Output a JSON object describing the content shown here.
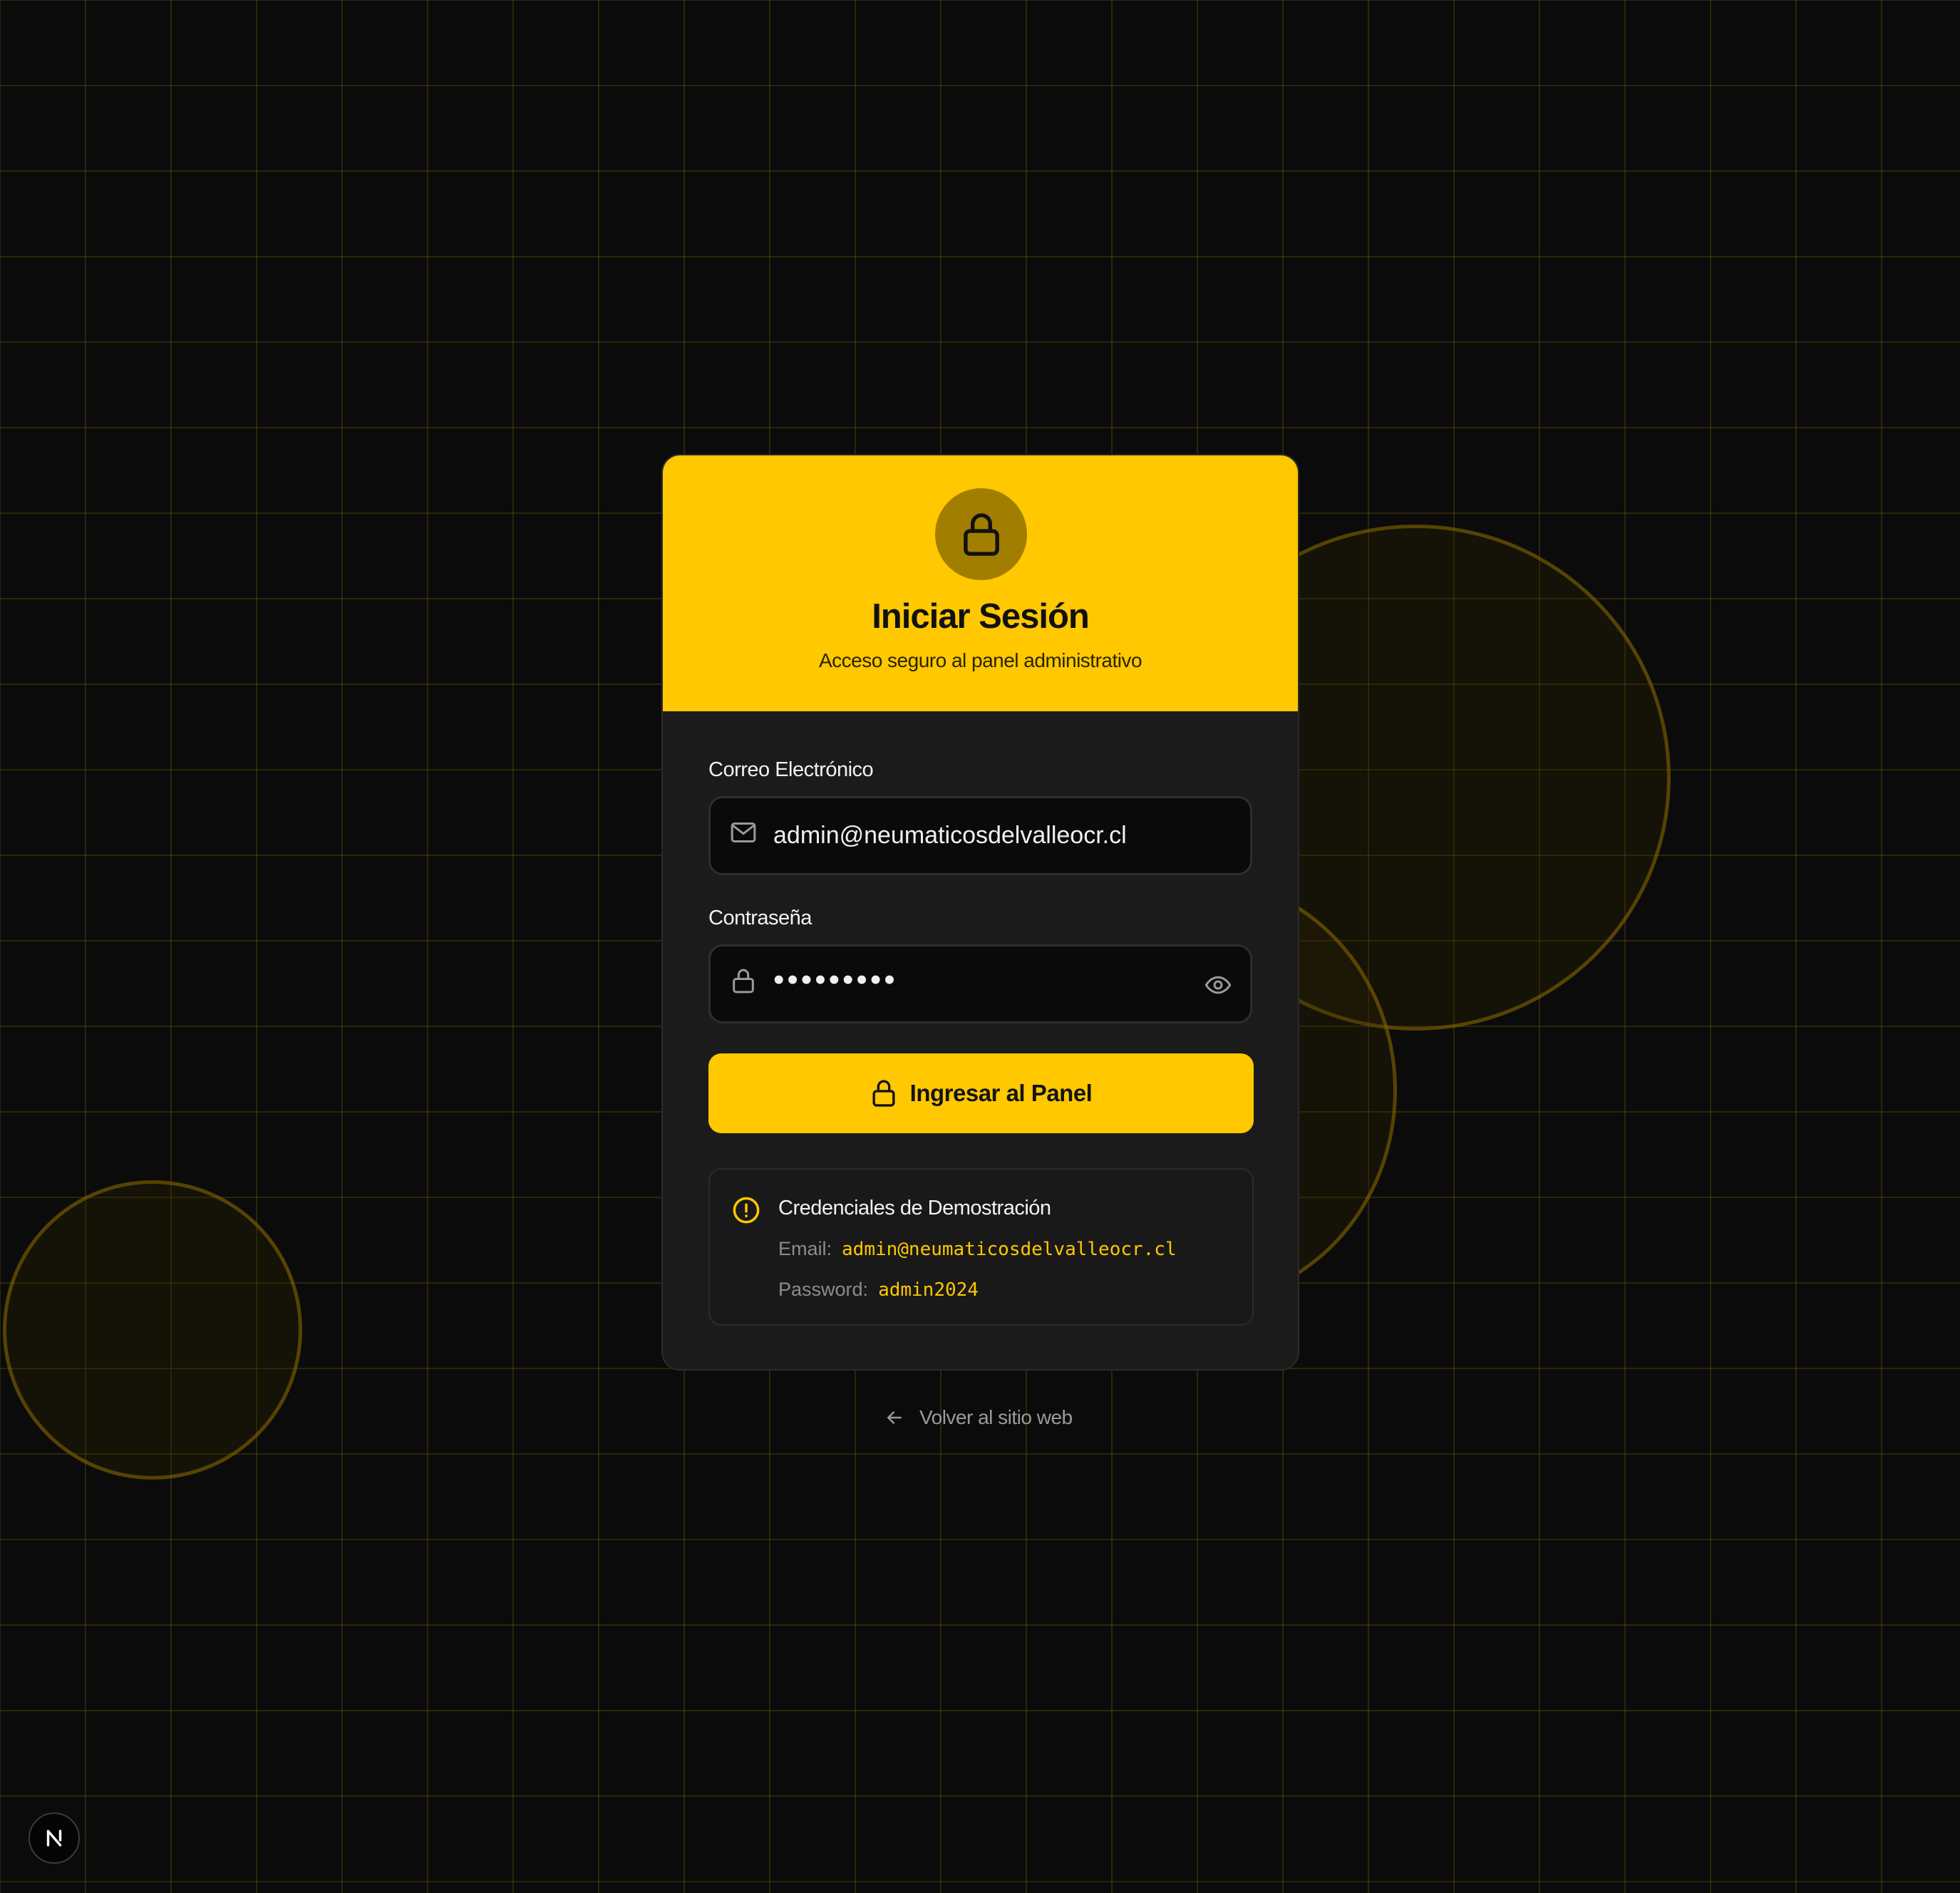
{
  "card": {
    "title": "Iniciar Sesión",
    "subtitle": "Acceso seguro al panel administrativo",
    "header_icon": "lock-icon"
  },
  "form": {
    "email": {
      "label": "Correo Electrónico",
      "value": "admin@neumaticosdelvalleocr.cl",
      "icon": "mail-icon"
    },
    "password": {
      "label": "Contraseña",
      "masked_value": "•••••••••",
      "icon": "lock-icon",
      "toggle_icon": "eye-icon"
    },
    "submit": {
      "label": "Ingresar al Panel",
      "icon": "lock-icon"
    }
  },
  "demo": {
    "title": "Credenciales de Demostración",
    "icon": "alert-circle-icon",
    "email_key": "Email:",
    "email_value": "admin@neumaticosdelvalleocr.cl",
    "password_key": "Password:",
    "password_value": "admin2024"
  },
  "back_link": {
    "label": "Volver al sitio web",
    "icon": "arrow-left-icon"
  },
  "badge": {
    "label": "N"
  },
  "colors": {
    "accent": "#ffc800",
    "background": "#0b0b0b",
    "card": "#1b1b1b",
    "input": "#0a0a0a"
  }
}
